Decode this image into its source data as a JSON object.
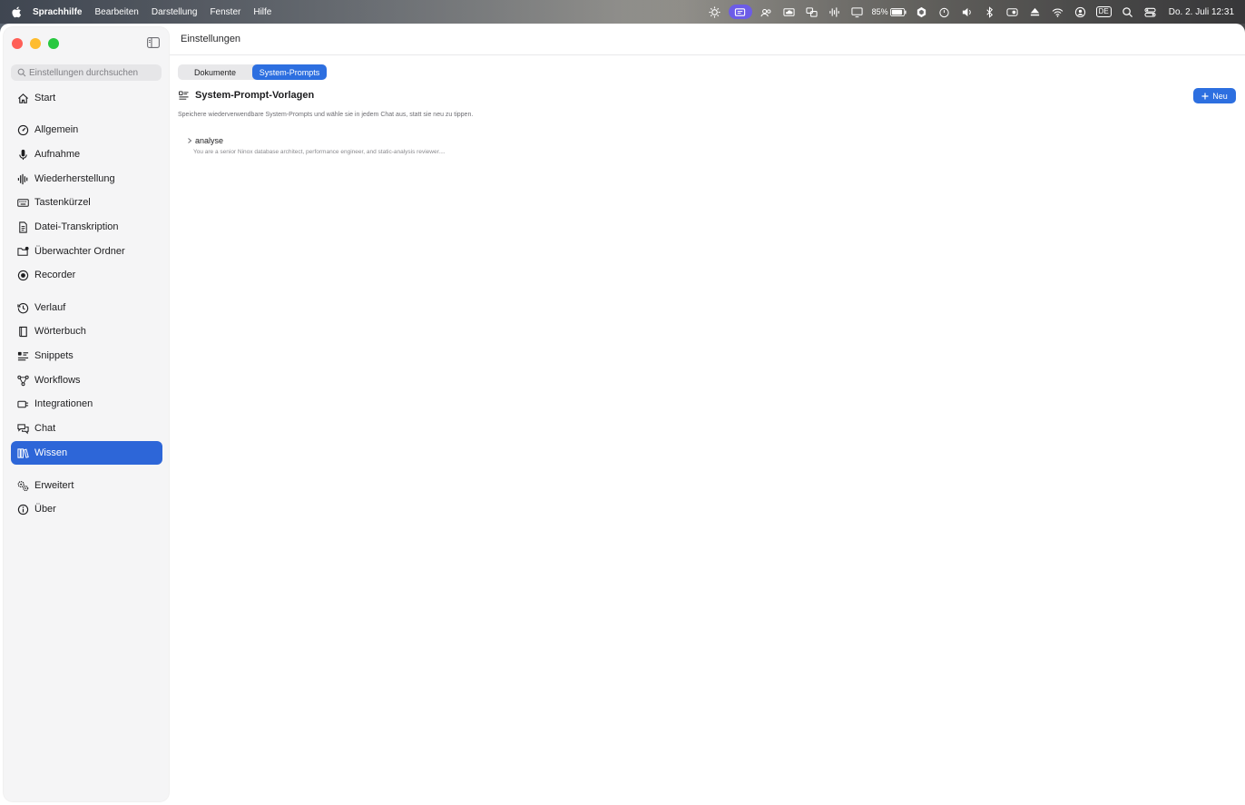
{
  "menubar": {
    "app_name": "Sprachhilfe",
    "menus": [
      "Bearbeiten",
      "Darstellung",
      "Fenster",
      "Hilfe"
    ],
    "battery_percent": "85%",
    "keyboard_layout": "DE",
    "clock": "Do. 2. Juli  12:31",
    "accent_color": "#6c5ce7"
  },
  "window": {
    "title": "Einstellungen"
  },
  "sidebar": {
    "search_placeholder": "Einstellungen durchsuchen",
    "items": [
      {
        "label": "Start",
        "icon": "house-icon"
      },
      {
        "label": "Allgemein",
        "icon": "gauge-icon"
      },
      {
        "label": "Aufnahme",
        "icon": "microphone-icon"
      },
      {
        "label": "Wiederherstellung",
        "icon": "waveform-icon"
      },
      {
        "label": "Tastenkürzel",
        "icon": "keyboard-icon"
      },
      {
        "label": "Datei-Transkription",
        "icon": "document-icon"
      },
      {
        "label": "Überwachter Ordner",
        "icon": "folder-badge-icon"
      },
      {
        "label": "Recorder",
        "icon": "record-icon"
      },
      {
        "label": "Verlauf",
        "icon": "history-icon"
      },
      {
        "label": "Wörterbuch",
        "icon": "book-icon"
      },
      {
        "label": "Snippets",
        "icon": "snippets-icon"
      },
      {
        "label": "Workflows",
        "icon": "workflow-icon"
      },
      {
        "label": "Integrationen",
        "icon": "plug-icon"
      },
      {
        "label": "Chat",
        "icon": "chat-bubbles-icon"
      },
      {
        "label": "Wissen",
        "icon": "books-icon",
        "active": true
      },
      {
        "label": "Erweitert",
        "icon": "gears-icon"
      },
      {
        "label": "Über",
        "icon": "info-icon"
      }
    ],
    "active_color": "#2d66d8"
  },
  "main": {
    "tabs": [
      {
        "label": "Dokumente",
        "selected": false
      },
      {
        "label": "System-Prompts",
        "selected": true
      }
    ],
    "section_title": "System-Prompt-Vorlagen",
    "new_button_label": "Neu",
    "description": "Speichere wiederverwendbare System-Prompts und wähle sie in jedem Chat aus, statt sie neu zu tippen.",
    "prompts": [
      {
        "name": "analyse",
        "preview": "You are a senior Ninox database architect, performance engineer, and static-analysis reviewer...."
      }
    ],
    "accent_color": "#2d6fe0"
  }
}
